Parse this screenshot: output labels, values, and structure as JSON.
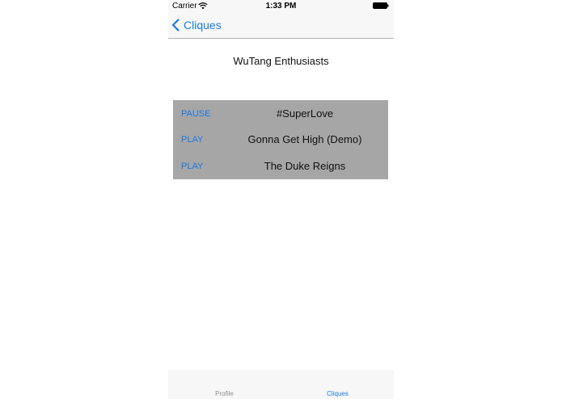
{
  "status_bar": {
    "carrier": "Carrier",
    "time": "1:33 PM"
  },
  "nav": {
    "back_label": "Cliques"
  },
  "group": {
    "title": "WuTang Enthusiasts"
  },
  "songs": [
    {
      "action": "PAUSE",
      "title": "#SuperLove"
    },
    {
      "action": "PLAY",
      "title": "Gonna Get High (Demo)"
    },
    {
      "action": "PLAY",
      "title": "The Duke Reigns"
    }
  ],
  "tabs": [
    {
      "label": "Profile",
      "selected": false
    },
    {
      "label": "Cliques",
      "selected": true
    }
  ],
  "colors": {
    "accent": "#1a7ae6",
    "list_background": "#a6a6a6",
    "bar_background": "#f7f7f7"
  },
  "icons": {
    "wifi": "wifi-icon",
    "battery": "battery-icon",
    "back": "chevron-left-icon"
  }
}
